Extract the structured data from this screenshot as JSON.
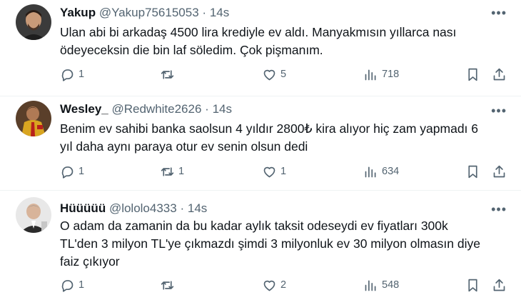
{
  "tweets": [
    {
      "name": "Yakup",
      "handle": "@Yakup75615053",
      "separator": "·",
      "time": "14s",
      "lines": [
        "Ulan abi bi arkadaş 4500 lira krediyle ev aldı. Manyakmısın yıllarca nası",
        "ödeyeceksin die bin laf söledim. Çok pişmanım."
      ],
      "replies": "1",
      "retweets": "",
      "likes": "5",
      "views": "718"
    },
    {
      "name": "Wesley_",
      "handle": "@Redwhite2626",
      "separator": "·",
      "time": "14s",
      "lines": [
        "Benim ev sahibi banka saolsun 4 yıldır 2800₺ kira alıyor hiç zam yapmadı 6",
        "yıl daha aynı paraya otur ev senin olsun dedi"
      ],
      "replies": "1",
      "retweets": "1",
      "likes": "1",
      "views": "634"
    },
    {
      "name": "Hüüüüü",
      "handle": "@lololo4333",
      "separator": "·",
      "time": "14s",
      "lines": [
        "O adam da zamanin da bu kadar aylık taksit odeseydi ev fiyatları 300k",
        "TL'den 3 milyon TL'ye çıkmazdı şimdi 3 milyonluk ev 30 milyon olmasın diye",
        "faiz çıkıyor"
      ],
      "replies": "1",
      "retweets": "",
      "likes": "2",
      "views": "548"
    }
  ],
  "icons": {
    "more": "more-horizontal-icon",
    "reply": "reply-bubble-icon",
    "retweet": "retweet-arrows-icon",
    "like": "heart-icon",
    "views": "views-bar-chart-icon",
    "bookmark": "bookmark-icon",
    "share": "share-upload-icon"
  },
  "colors": {
    "text": "#0f1419",
    "muted": "#536471",
    "divider": "#eff3f4"
  }
}
